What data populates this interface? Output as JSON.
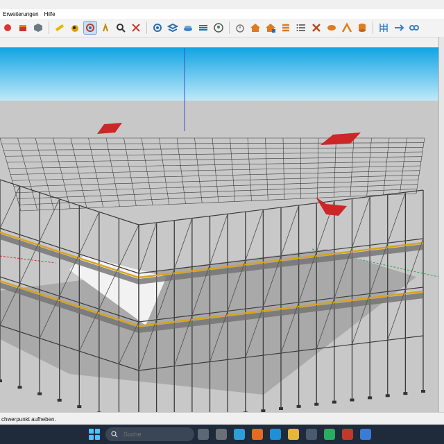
{
  "menu": {
    "items": [
      "Erweiterungen",
      "Hilfe"
    ]
  },
  "status": {
    "text": "chwerpunkt aufheben."
  },
  "taskbar": {
    "search_placeholder": "Suche"
  },
  "colors": {
    "sky_top": "#12a4e3",
    "sky_bottom": "#bfe9f9",
    "ground": "#c8c8c8",
    "scaffold": "#3a3a3a",
    "board_edge": "#d9a21a",
    "deck": "#707070",
    "red_marker": "#cc2626",
    "taskbar_bg": "#1f2b3a",
    "accent": "#4cc2ff"
  },
  "icons": [
    "red-tool-icon",
    "box-icon",
    "component-icon",
    "measure-icon",
    "paint-icon",
    "orbit-icon",
    "walk-icon",
    "zoom-icon",
    "zoom-extents-icon",
    "settings-icon",
    "layers-icon",
    "sandbox-icon",
    "materials-icon",
    "profile-icon",
    "stopwatch-icon",
    "house-icon",
    "house-plus-icon",
    "stack-icon",
    "list-icon",
    "tools-icon",
    "tag-icon",
    "roof-icon",
    "database-icon",
    "scaffold-icon",
    "move-icon",
    "link-icon"
  ]
}
